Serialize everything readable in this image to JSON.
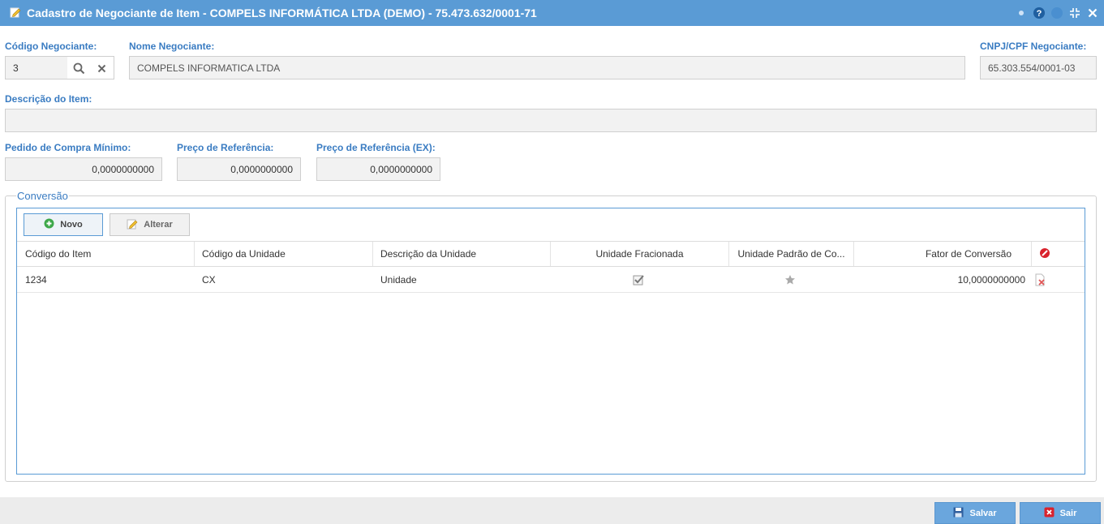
{
  "window": {
    "title": "Cadastro de Negociante de Item - COMPELS INFORMÁTICA LTDA (DEMO) - 75.473.632/0001-71"
  },
  "form": {
    "codigo_negociante": {
      "label": "Código Negociante:",
      "value": "3"
    },
    "nome_negociante": {
      "label": "Nome Negociante:",
      "value": "COMPELS INFORMATICA LTDA"
    },
    "cnpj_negociante": {
      "label": "CNPJ/CPF Negociante:",
      "value": "65.303.554/0001-03"
    },
    "descricao_item": {
      "label": "Descrição do Item:",
      "value": ""
    },
    "pedido_minimo": {
      "label": "Pedido de Compra Mínimo:",
      "value": "0,0000000000"
    },
    "preco_referencia": {
      "label": "Preço de Referência:",
      "value": "0,0000000000"
    },
    "preco_referencia_ex": {
      "label": "Preço de Referência (EX):",
      "value": "0,0000000000"
    }
  },
  "conversao": {
    "legend": "Conversão",
    "buttons": {
      "novo": "Novo",
      "alterar": "Alterar"
    },
    "columns": [
      "Código do Item",
      "Código da Unidade",
      "Descrição da Unidade",
      "Unidade Fracionada",
      "Unidade Padrão de Co...",
      "Fator de Conversão"
    ],
    "rows": [
      {
        "codigo_item": "1234",
        "codigo_unidade": "CX",
        "descricao_unidade": "Unidade",
        "fracionada": true,
        "padrao": true,
        "fator": "10,0000000000"
      }
    ]
  },
  "footer": {
    "salvar": "Salvar",
    "sair": "Sair"
  },
  "colors": {
    "accent": "#5a9bd5",
    "label": "#3a7cc2",
    "danger": "#d9232d"
  }
}
